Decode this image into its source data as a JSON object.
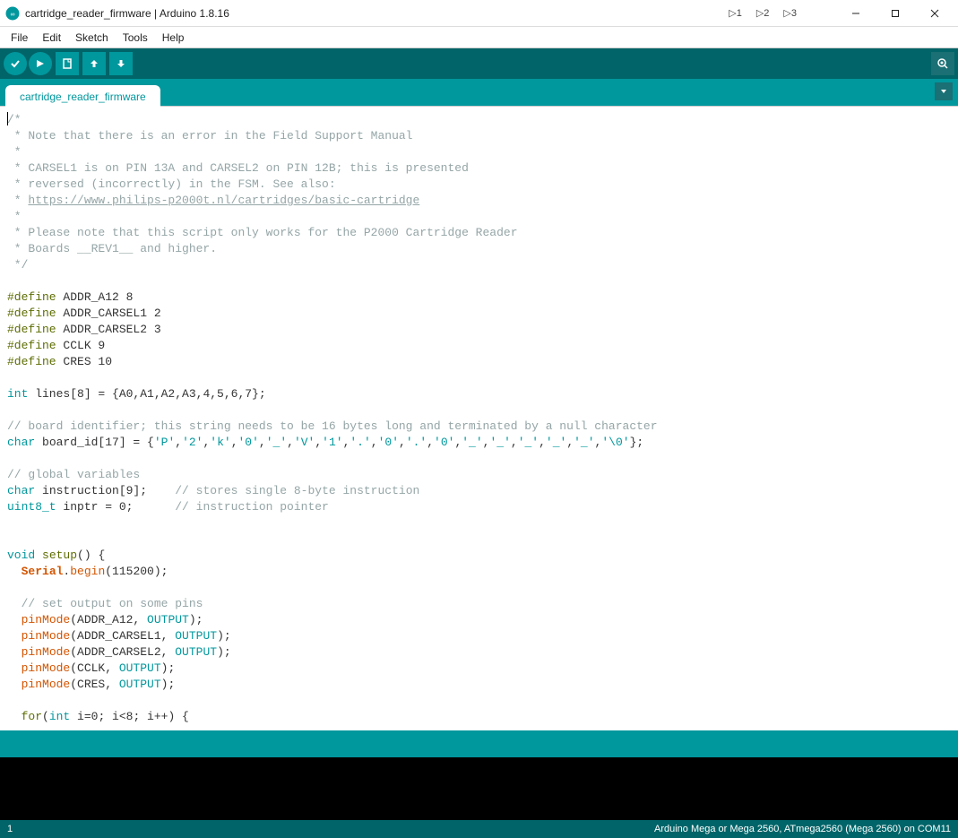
{
  "window": {
    "title": "cartridge_reader_firmware | Arduino 1.8.16",
    "dbg1": "▷1",
    "dbg2": "▷2",
    "dbg3": "▷3"
  },
  "menu": {
    "file": "File",
    "edit": "Edit",
    "sketch": "Sketch",
    "tools": "Tools",
    "help": "Help"
  },
  "toolbar": {
    "verify": "verify",
    "upload": "upload",
    "new": "new",
    "open": "open",
    "save": "save",
    "serial": "serial-monitor"
  },
  "tabs": [
    {
      "label": "cartridge_reader_firmware"
    }
  ],
  "footer": {
    "line": "1",
    "board": "Arduino Mega or Mega 2560, ATmega2560 (Mega 2560) on COM11"
  },
  "code": {
    "l01": "/*",
    "l02": " * Note that there is an error in the Field Support Manual",
    "l03": " *",
    "l04": " * CARSEL1 is on PIN 13A and CARSEL2 on PIN 12B; this is presented",
    "l05": " * reversed (incorrectly) in the FSM. See also:",
    "l06a": " * ",
    "l06b": "https://www.philips-p2000t.nl/cartridges/basic-cartridge",
    "l07": " *",
    "l08": " * Please note that this script only works for the P2000 Cartridge Reader",
    "l09": " * Boards __REV1__ and higher.",
    "l10": " */",
    "def": "#define",
    "d1": " ADDR_A12 8",
    "d2": " ADDR_CARSEL1 2",
    "d3": " ADDR_CARSEL2 3",
    "d4": " CCLK 9",
    "d5": " CRES 10",
    "int": "int",
    "lines": " lines[8] = {A0,A1,A2,A3,4,5,6,7};",
    "c_board": "// board identifier; this string needs to be 16 bytes long and terminated by a null character",
    "char": "char",
    "bid_a": " board_id[17] = {",
    "bid_b": "'P'",
    "bid_c": ",",
    "s2": "'2'",
    "sk": "'k'",
    "s0": "'0'",
    "su": "'_'",
    "sV": "'V'",
    "s1": "'1'",
    "sd": "'.'",
    "sn": "'\\0'",
    "bid_end": "};",
    "c_glob": "// global variables",
    "instr_a": " instruction[9];    ",
    "c_instr": "// stores single 8-byte instruction",
    "u8": "uint8_t",
    "inptr_a": " inptr = 0;      ",
    "c_inptr": "// instruction pointer",
    "void": "void",
    "setup": "setup",
    "setup_b": "() {",
    "serial": "Serial",
    "begin": "begin",
    "begin_b": "(115200);",
    "c_pins": "// set output on some pins",
    "pinmode": "pinMode",
    "pm1a": "(ADDR_A12, ",
    "pm2a": "(ADDR_CARSEL1, ",
    "pm3a": "(ADDR_CARSEL2, ",
    "pm4a": "(CCLK, ",
    "pm5a": "(CRES, ",
    "output": "OUTPUT",
    "pm_end": ");",
    "for": "for",
    "for_a": "(",
    "for_b": " i=0; i<8; i++) {"
  }
}
